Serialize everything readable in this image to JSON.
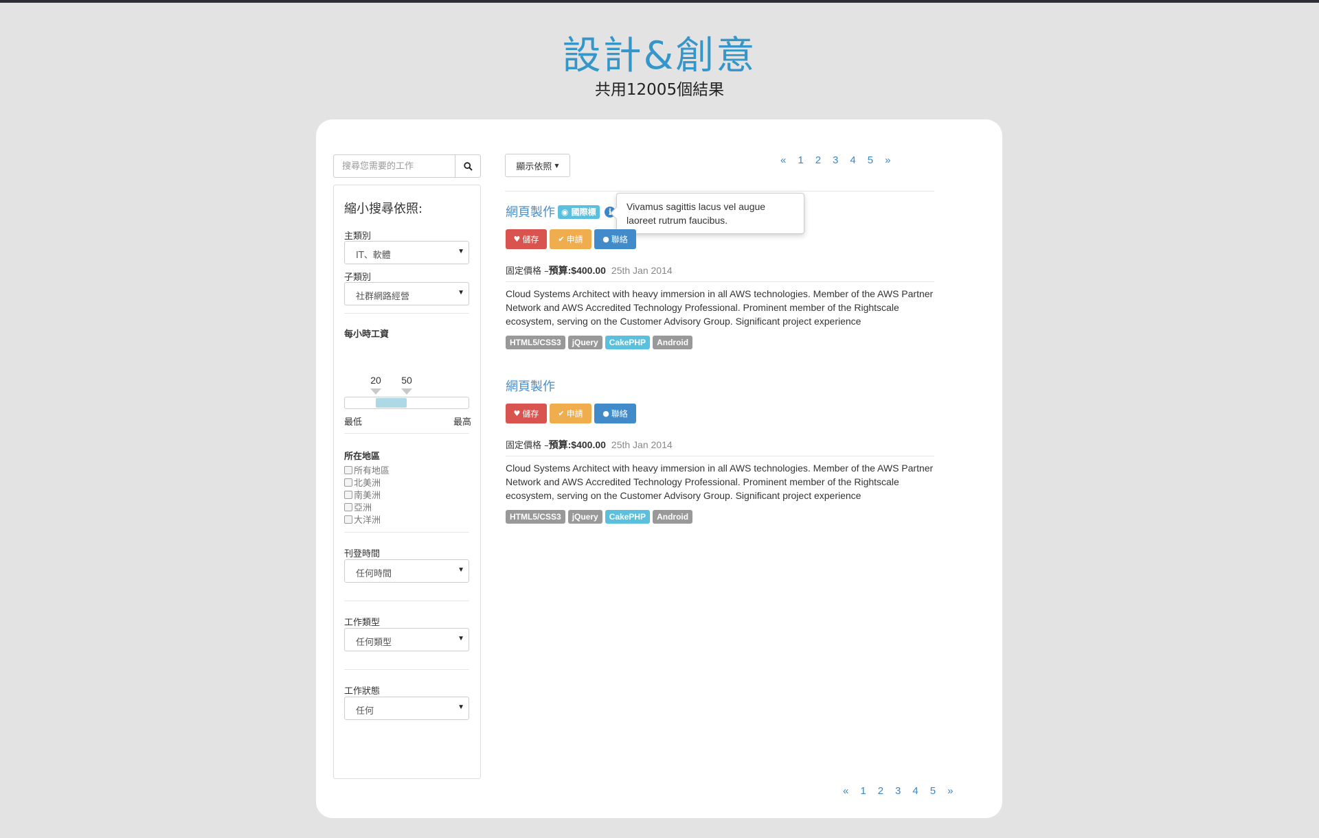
{
  "page": {
    "title": "設計&創意",
    "subtitle": "共用12005個結果"
  },
  "search": {
    "placeholder": "搜尋您需要的工作",
    "icon": "search-icon"
  },
  "filters": {
    "heading": "縮小搜尋依照:",
    "category": {
      "label": "主類別",
      "value": "IT、軟體"
    },
    "subcategory": {
      "label": "子類別",
      "value": "社群網路經營"
    },
    "hourly_wage": {
      "label": "每小時工資",
      "min_value": "20",
      "max_value": "50",
      "low_label": "最低",
      "high_label": "最高",
      "range_start_fraction": 0.25,
      "range_end_fraction": 0.5
    },
    "region": {
      "label": "所在地區",
      "options": [
        "所有地區",
        "北美洲",
        "南美洲",
        "亞洲",
        "大洋洲"
      ]
    },
    "posted_time": {
      "label": "刊登時間",
      "value": "任何時間"
    },
    "job_type": {
      "label": "工作類型",
      "value": "任何類型"
    },
    "job_status": {
      "label": "工作狀態",
      "value": "任何"
    }
  },
  "toolbar": {
    "sort_label": "顯示依照"
  },
  "pagination": {
    "prev": "«",
    "pages": [
      "1",
      "2",
      "3",
      "4",
      "5"
    ],
    "next": "»"
  },
  "tooltip": {
    "text": "Vivamus sagittis lacus vel augue laoreet rutrum faucibus."
  },
  "jobs": [
    {
      "title": "網頁製作",
      "badge": "國際標",
      "save": "儲存",
      "apply": "申請",
      "contact": "聯絡",
      "price_type": "固定價格 – ",
      "budget": "預算:$400.00",
      "date": "25th Jan 2014",
      "description": "Cloud Systems Architect with heavy immersion in all AWS technologies. Member of the AWS Partner Network and AWS Accredited Technology Professional. Prominent member of the Rightscale ecosystem, serving on the Customer Advisory Group. Significant project experience",
      "tags": [
        "HTML5/CSS3",
        "jQuery",
        "CakePHP",
        "Android"
      ]
    },
    {
      "title": "網頁製作",
      "save": "儲存",
      "apply": "申請",
      "contact": "聯絡",
      "price_type": "固定價格 – ",
      "budget": "預算:$400.00",
      "date": "25th Jan 2014",
      "description": "Cloud Systems Architect with heavy immersion in all AWS technologies. Member of the AWS Partner Network and AWS Accredited Technology Professional. Prominent member of the Rightscale ecosystem, serving on the Customer Advisory Group. Significant project experience",
      "tags": [
        "HTML5/CSS3",
        "jQuery",
        "CakePHP",
        "Android"
      ]
    }
  ],
  "colors": {
    "accent": "#3596c9",
    "danger": "#d9534f",
    "warning": "#f0ad4e",
    "primary": "#428bca",
    "info": "#5bc0de",
    "tag_default": "#999999"
  }
}
